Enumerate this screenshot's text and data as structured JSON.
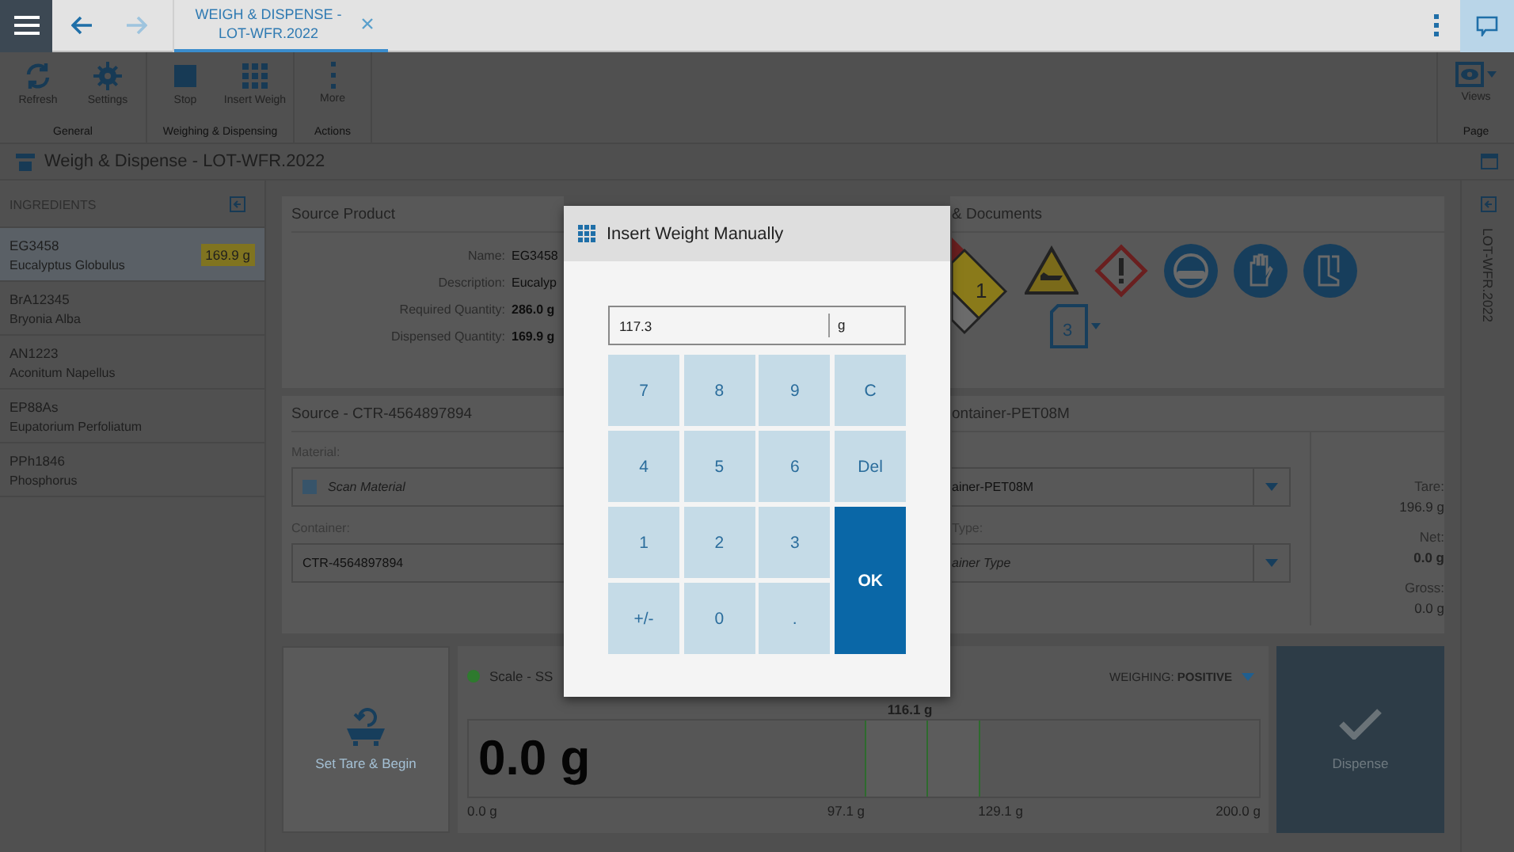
{
  "top_bar": {
    "nav": [
      {
        "kind": "back",
        "disabled": false
      },
      {
        "kind": "forward",
        "disabled": true
      }
    ],
    "tabs": [
      {
        "title": "WEIGH & DISPENSE - LOT-WFR.2022",
        "selected": true
      }
    ]
  },
  "ribbon": {
    "groups": [
      {
        "label": "General",
        "buttons": [
          {
            "kind": "refresh",
            "label": "Refresh"
          },
          {
            "kind": "settings",
            "label": "Settings"
          }
        ]
      },
      {
        "label": "Weighing & Dispensing",
        "buttons": [
          {
            "kind": "stop",
            "label": "Stop"
          },
          {
            "kind": "grid",
            "label": "Insert Weigh"
          }
        ]
      },
      {
        "label": "Actions",
        "buttons": [
          {
            "kind": "more",
            "label": "More"
          }
        ]
      }
    ],
    "page_group": {
      "label": "Page",
      "buttons": [
        {
          "kind": "views",
          "label": "Views"
        }
      ]
    }
  },
  "page_title": "Weigh & Dispense - LOT-WFR.2022",
  "sidebar": {
    "title": "INGREDIENTS",
    "items": [
      {
        "code": "EG3458",
        "name": "Eucalyptus Globulus",
        "badge": "169.9 g",
        "selected": true
      },
      {
        "code": "BrA12345",
        "name": "Bryonia Alba",
        "selected": false
      },
      {
        "code": "AN1223",
        "name": "Aconitum Napellus",
        "selected": false
      },
      {
        "code": "EP88As",
        "name": "Eupatorium Perfoliatum",
        "selected": false
      },
      {
        "code": "PPh1846",
        "name": "Phosphorus",
        "selected": false
      }
    ]
  },
  "source_product": {
    "title": "Source Product",
    "rows": [
      {
        "label": "Name:",
        "value": "EG3458",
        "bold": false
      },
      {
        "label": "Description:",
        "value": "Eucalyp",
        "bold": false
      },
      {
        "label": "Required Quantity:",
        "value": "286.0 g",
        "bold": true
      },
      {
        "label": "Dispensed Quantity:",
        "value": "169.9 g",
        "bold": true
      }
    ]
  },
  "hazards": {
    "title": "& Documents",
    "nfpa_value": "1",
    "documents_count": "3"
  },
  "source": {
    "title": "Source - CTR-4564897894",
    "fields": [
      {
        "kind": "scan",
        "label": "Material:",
        "placeholder": "Scan Material"
      },
      {
        "kind": "text",
        "label": "Container:",
        "value": "CTR-4564897894"
      }
    ]
  },
  "target": {
    "title": "ontainer-PET08M",
    "fields": [
      {
        "kind": "dropdown",
        "value": "ainer-PET08M"
      },
      {
        "kind": "dropdown",
        "label": "Type:",
        "placeholder": "ainer Type"
      }
    ],
    "weights": [
      {
        "label": "Tare:",
        "value": "196.9 g",
        "bold": false
      },
      {
        "label": "Net:",
        "value": "0.0 g",
        "bold": true
      },
      {
        "label": "Gross:",
        "value": "0.0 g",
        "bold": false
      }
    ]
  },
  "tare_button": "Set Tare & Begin",
  "scale": {
    "name": "Scale - SS",
    "connected": true,
    "mode": "WEIGHING: **POSITIVE**",
    "reading": "0.0 g",
    "target": "116.1 g",
    "level": 0,
    "ticks": [
      "0.0 g",
      "97.1 g",
      "129.1 g",
      "200.0 g"
    ]
  },
  "dispense_button": "Dispense",
  "right_rail": {
    "label": "LOT-WFR.2022"
  },
  "dialog": {
    "title": "Insert Weight Manually",
    "value": "117.3",
    "unit": "g",
    "keys": [
      {
        "label": "7",
        "kind": "digit"
      },
      {
        "label": "8",
        "kind": "digit"
      },
      {
        "label": "9",
        "kind": "digit"
      },
      {
        "label": "C",
        "kind": "action"
      },
      {
        "label": "4",
        "kind": "digit"
      },
      {
        "label": "5",
        "kind": "digit"
      },
      {
        "label": "6",
        "kind": "digit"
      },
      {
        "label": "Del",
        "kind": "action"
      },
      {
        "label": "1",
        "kind": "digit"
      },
      {
        "label": "2",
        "kind": "digit"
      },
      {
        "label": "3",
        "kind": "digit"
      },
      {
        "label": "OK",
        "kind": "ok"
      },
      {
        "label": "+/-",
        "kind": "action"
      },
      {
        "label": "0",
        "kind": "digit"
      },
      {
        "label": ".",
        "kind": "digit"
      }
    ]
  }
}
